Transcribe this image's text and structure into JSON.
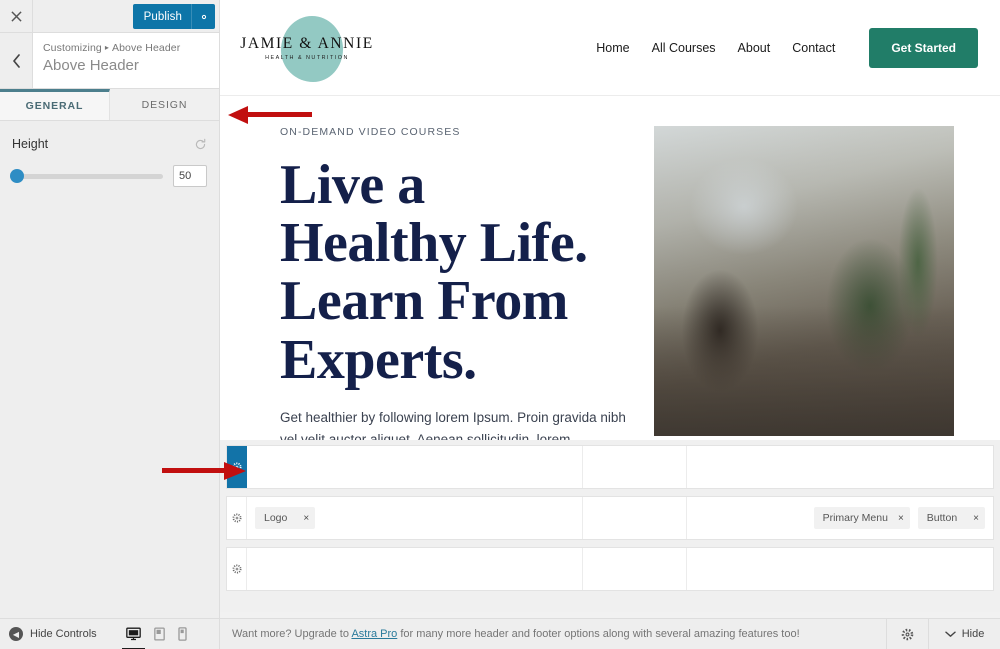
{
  "customizer": {
    "close_label": "×",
    "publish_label": "Publish",
    "publish_gear_icon": "gear-icon",
    "back_icon": "chevron-left-icon",
    "breadcrumb_root": "Customizing",
    "breadcrumb_sep": "▸",
    "breadcrumb_current": "Above Header",
    "panel_title": "Above Header",
    "tabs": [
      {
        "label": "GENERAL",
        "active": true
      },
      {
        "label": "DESIGN",
        "active": false
      }
    ],
    "controls": {
      "height": {
        "label": "Height",
        "value": "50",
        "reset_icon": "reset-icon",
        "slider_percent": 3
      }
    }
  },
  "site": {
    "logo": {
      "name": "JAMIE & ANNIE",
      "tagline": "HEALTH & NUTRITION"
    },
    "nav": [
      {
        "label": "Home"
      },
      {
        "label": "All Courses"
      },
      {
        "label": "About"
      },
      {
        "label": "Contact"
      }
    ],
    "cta": {
      "label": "Get Started",
      "color": "#217d68"
    },
    "hero": {
      "eyebrow": "ON-DEMAND VIDEO COURSES",
      "title_line1": "Live a",
      "title_line2": "Healthy Life.",
      "title_line3": "Learn From",
      "title_line4": "Experts.",
      "title_color": "#14204a",
      "paragraph": "Get healthier by following lorem Ipsum. Proin gravida nibh vel velit auctor aliquet. Aenean sollicitudin, lorem",
      "image_alt": "woman-doing-yoga-plank-pose-in-studio-with-plants"
    }
  },
  "builder": {
    "rows": [
      {
        "name": "above-header-row",
        "gear_icon": "gear-icon",
        "gear_active": true,
        "left_items": [],
        "center_items": [],
        "right_items": []
      },
      {
        "name": "primary-header-row",
        "gear_icon": "gear-icon",
        "gear_active": false,
        "left_items": [
          {
            "label": "Logo",
            "remove": "×"
          }
        ],
        "center_items": [],
        "right_items": [
          {
            "label": "Primary Menu",
            "remove": "×"
          },
          {
            "label": "Button",
            "remove": "×"
          }
        ]
      },
      {
        "name": "below-header-row",
        "gear_icon": "gear-icon",
        "gear_active": false,
        "left_items": [],
        "center_items": [],
        "right_items": []
      }
    ]
  },
  "bottombar": {
    "hide_controls_label": "Hide Controls",
    "hide_controls_icon": "collapse-left-icon",
    "devices": [
      {
        "name": "desktop",
        "icon": "desktop-icon",
        "active": true
      },
      {
        "name": "tablet",
        "icon": "tablet-icon",
        "active": false
      },
      {
        "name": "mobile",
        "icon": "mobile-icon",
        "active": false
      }
    ],
    "upsell_prefix": "Want more? Upgrade to ",
    "upsell_link": "Astra Pro",
    "upsell_suffix": " for many more header and footer options along with several amazing features too!",
    "gear_icon": "gear-icon",
    "hide_label": "Hide",
    "hide_icon": "chevron-down-icon"
  },
  "annotations": {
    "arrow_color": "#c10f0f",
    "arrow_tabs_direction": "left",
    "arrow_row_direction": "right"
  }
}
